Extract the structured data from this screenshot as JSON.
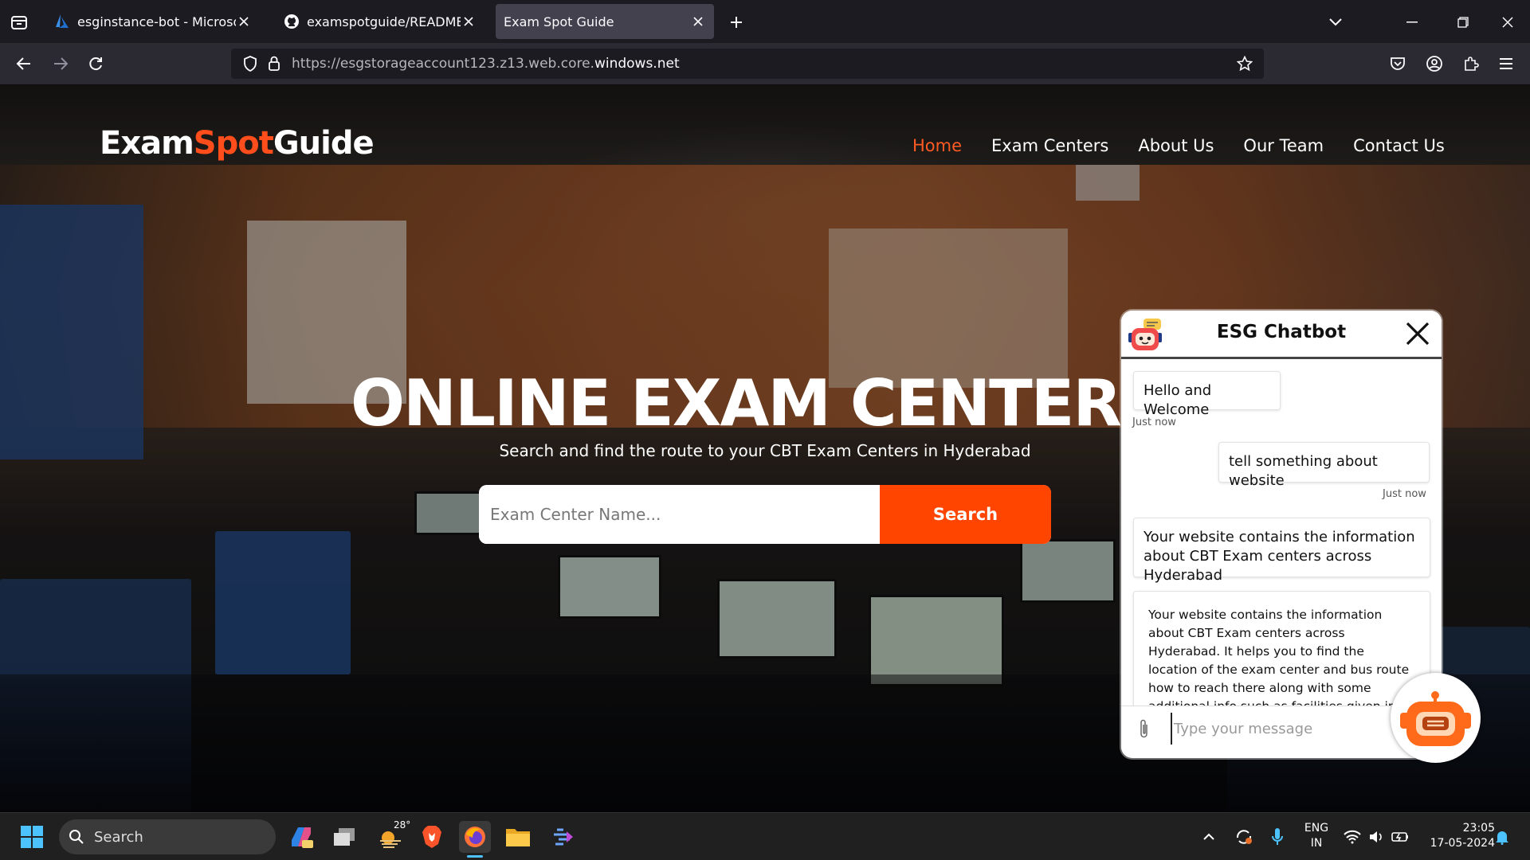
{
  "browser": {
    "tabs": [
      {
        "title": "esginstance-bot - Microsoft Azure",
        "active": false
      },
      {
        "title": "examspotguide/README.md at",
        "active": false
      },
      {
        "title": "Exam Spot Guide",
        "active": true
      }
    ],
    "url": {
      "base": "https://esgstorageaccount123.z13.web.core.",
      "domain": "windows.net"
    }
  },
  "site": {
    "logo": {
      "part1": "Exam",
      "part2": "Spot",
      "part3": "Guide"
    },
    "nav": [
      "Home",
      "Exam Centers",
      "About Us",
      "Our Team",
      "Contact Us"
    ],
    "hero_title": "ONLINE EXAM CENTER",
    "hero_subtitle": "Search and find the route to your CBT Exam Centers in Hyderabad",
    "search_placeholder": "Exam Center Name...",
    "search_button": "Search",
    "accent_color": "#ff4500"
  },
  "chatbot": {
    "title": "ESG Chatbot",
    "messages": [
      {
        "from": "bot",
        "text": "Hello and Welcome",
        "time": "Just now"
      },
      {
        "from": "user",
        "text": "tell something about website",
        "time": "Just now"
      },
      {
        "from": "bot",
        "text": "Your website contains the information about CBT Exam centers across Hyderabad"
      },
      {
        "from": "bot",
        "text": "Your website contains the information about CBT Exam centers across Hyderabad. It helps you to find the location of the exam center and bus route how to reach there along with some additional info such as facilities given in the centers."
      }
    ],
    "input_placeholder": "Type your message"
  },
  "taskbar": {
    "search_label": "Search",
    "weather_temp": "28°",
    "language": "ENG",
    "region": "IN",
    "time": "23:05",
    "date": "17-05-2024"
  }
}
